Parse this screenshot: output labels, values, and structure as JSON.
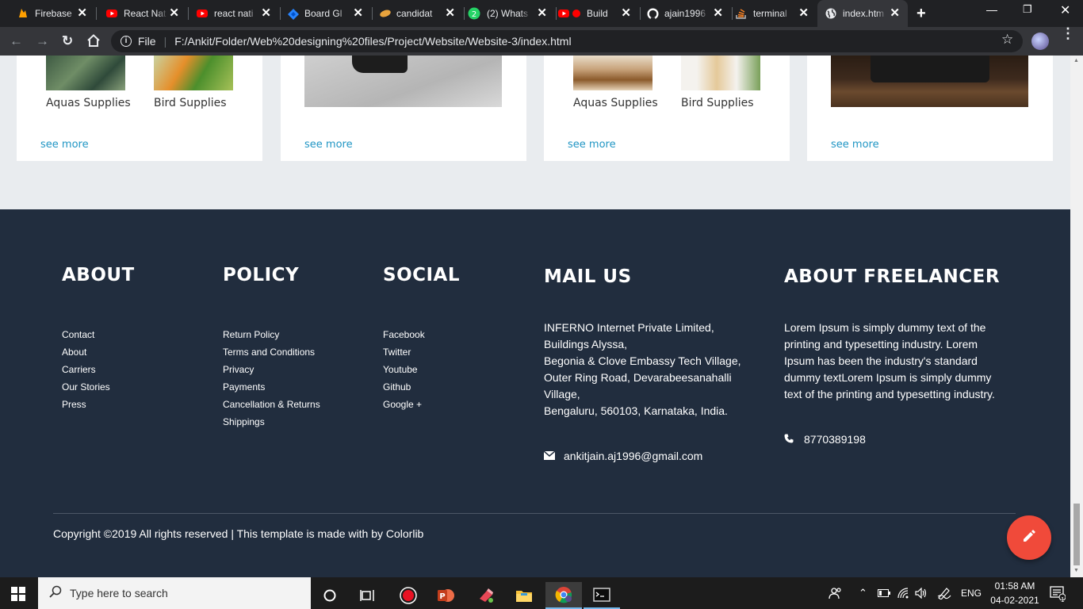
{
  "browser": {
    "tabs": [
      {
        "label": "Firebase",
        "icon": "firebase-icon",
        "color": "#ffa000"
      },
      {
        "label": "React Nat",
        "icon": "youtube-icon",
        "color": "#ff0000"
      },
      {
        "label": "react nati",
        "icon": "youtube-icon",
        "color": "#ff0000"
      },
      {
        "label": "Board Gl",
        "icon": "jira-icon",
        "color": "#2684ff"
      },
      {
        "label": "candidat",
        "icon": "candidate-icon",
        "color": "#e8a33d"
      },
      {
        "label": "(2) Whats",
        "icon": "whatsapp-icon",
        "color": "#25d366"
      },
      {
        "label": "Build",
        "icon": "youtube-icon",
        "color": "#ff0000"
      },
      {
        "label": "ajain1996",
        "icon": "github-icon",
        "color": "#ffffff"
      },
      {
        "label": "terminal",
        "icon": "stackoverflow-icon",
        "color": "#f48024"
      },
      {
        "label": "index.htm",
        "icon": "globe-icon",
        "color": "#e8eaed",
        "active": true
      }
    ],
    "new_tab": "+",
    "address": {
      "scheme_label": "File",
      "url": "F:/Ankit/Folder/Web%20designing%20files/Project/Website/Website-3/index.html"
    }
  },
  "cards": [
    {
      "items": [
        "Aquas Supplies",
        "Bird Supplies"
      ],
      "see_more": "see more"
    },
    {
      "see_more": "see more"
    },
    {
      "items": [
        "Aquas Supplies",
        "Bird Supplies"
      ],
      "see_more": "see more"
    },
    {
      "see_more": "see more"
    }
  ],
  "footer": {
    "about": {
      "heading": "ABOUT",
      "links": [
        "Contact",
        "About",
        "Carriers",
        "Our Stories",
        "Press"
      ]
    },
    "policy": {
      "heading": "POLICY",
      "links": [
        "Return Policy",
        "Terms and Conditions",
        "Privacy",
        "Payments",
        "Cancellation & Returns",
        "Shippings"
      ]
    },
    "social": {
      "heading": "SOCIAL",
      "links": [
        "Facebook",
        "Twitter",
        "Youtube",
        "Github",
        "Google +"
      ]
    },
    "mail": {
      "heading": "MAIL US",
      "address_lines": [
        "INFERNO Internet Private Limited,",
        "Buildings Alyssa,",
        "Begonia & Clove Embassy Tech Village,",
        "Outer Ring Road, Devarabeesanahalli",
        "Village,",
        "Bengaluru, 560103, Karnataka, India."
      ],
      "email": "ankitjain.aj1996@gmail.com"
    },
    "freelancer": {
      "heading": "ABOUT FREELANCER",
      "lines": [
        "Lorem Ipsum is simply dummy text of the",
        "printing and typesetting industry. Lorem",
        "Ipsum has been the industry's standard",
        "dummy textLorem Ipsum is simply dummy",
        "text of the printing and typesetting industry."
      ],
      "phone": "8770389198"
    },
    "copyright": "Copyright ©2019 All rights reserved | This template is made with by Colorlib"
  },
  "taskbar": {
    "search_placeholder": "Type here to search",
    "language": "ENG",
    "time": "01:58 AM",
    "date": "04-02-2021",
    "notification_count": "1"
  }
}
